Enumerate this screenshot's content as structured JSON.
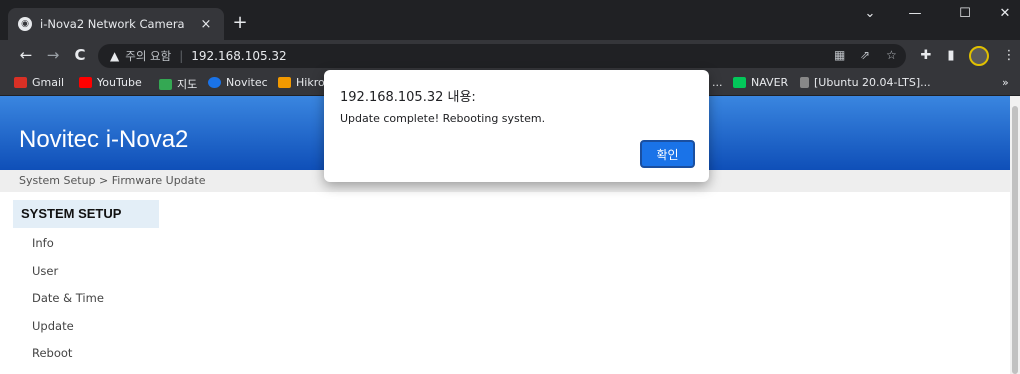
{
  "browser": {
    "tab": {
      "title": "i-Nova2 Network Camera",
      "close": "×"
    },
    "new_tab": "+",
    "window_controls": {
      "minimize": "—",
      "maximize": "☐",
      "close": "✕",
      "dropdown": "⌄"
    },
    "toolbar": {
      "back": "←",
      "forward": "→",
      "reload": "C",
      "security_icon": "▲",
      "security_text": "주의 요함",
      "url": "192.168.105.32"
    },
    "bookmarks": [
      {
        "label": "Gmail",
        "color": "#d93025"
      },
      {
        "label": "YouTube",
        "color": "#ff0000"
      },
      {
        "label": "지도",
        "color": "#34a853"
      },
      {
        "label": "Novitec",
        "color": "#1a73e8"
      },
      {
        "label": "Hikro",
        "color": "#f29900"
      },
      {
        "label": "NAVER",
        "color": "#03c75a"
      },
      {
        "label": "[Ubuntu 20.04-LTS]...",
        "color": "#888888"
      }
    ],
    "bookmark_truncated": "...",
    "more": "»"
  },
  "page": {
    "brand": "Novitec i-Nova2",
    "breadcrumb": "System Setup > Firmware Update",
    "sidebar": {
      "heading": "SYSTEM SETUP",
      "items": [
        "Info",
        "User",
        "Date & Time",
        "Update",
        "Reboot"
      ]
    }
  },
  "dialog": {
    "title": "192.168.105.32 내용:",
    "message": "Update complete! Rebooting system.",
    "ok_label": "확인"
  },
  "colors": {
    "banner_top": "#3a86e0",
    "banner_bottom": "#0f4fb8",
    "ok_button": "#1a73e8"
  }
}
